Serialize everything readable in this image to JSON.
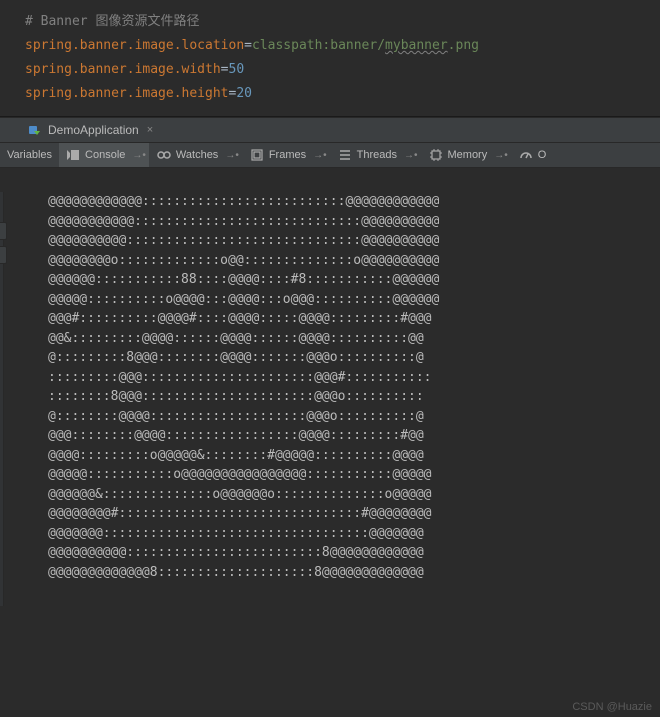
{
  "editor": {
    "comment": "# Banner 图像资源文件路径",
    "line1": {
      "key": "spring.banner.image.location",
      "eq": "=",
      "val_a": "classpath:banner/",
      "val_u": "mybanner",
      "val_c": ".png"
    },
    "line2": {
      "key": "spring.banner.image.width",
      "eq": "=",
      "val": "50"
    },
    "line3": {
      "key": "spring.banner.image.height",
      "eq": "=",
      "val": "20"
    }
  },
  "tab": {
    "name": "DemoApplication",
    "close": "×"
  },
  "toolbar": {
    "variables": "Variables",
    "console": "Console",
    "watches": "Watches",
    "frames": "Frames",
    "threads": "Threads",
    "memory": "Memory",
    "overhead": "O"
  },
  "banner_output": "@@@@@@@@@@@@::::::::::::::::::::::::::@@@@@@@@@@@@\n@@@@@@@@@@@:::::::::::::::::::::::::::::@@@@@@@@@@\n@@@@@@@@@@::::::::::::::::::::::::::::::@@@@@@@@@@\n@@@@@@@@o:::::::::::::o@@::::::::::::::o@@@@@@@@@@\n@@@@@@:::::::::::88::::@@@@::::#8:::::::::::@@@@@@\n@@@@@::::::::::o@@@@:::@@@@:::o@@@::::::::::@@@@@@\n@@@#::::::::::@@@@#::::@@@@:::::@@@@:::::::::#@@@\n@@&:::::::::@@@@::::::@@@@::::::@@@@::::::::::@@\n@:::::::::8@@@::::::::@@@@:::::::@@@o::::::::::@\n:::::::::@@@::::::::::::::::::::::@@@#:::::::::::\n::::::::8@@@::::::::::::::::::::::@@@o::::::::::\n@::::::::@@@@::::::::::::::::::::@@@o::::::::::@\n@@@::::::::@@@@:::::::::::::::::@@@@:::::::::#@@\n@@@@:::::::::o@@@@@&::::::::#@@@@@::::::::::@@@@\n@@@@@:::::::::::o@@@@@@@@@@@@@@@@:::::::::::@@@@@\n@@@@@@&::::::::::::::o@@@@@@o::::::::::::::o@@@@@\n@@@@@@@@#:::::::::::::::::::::::::::::::#@@@@@@@@\n@@@@@@@::::::::::::::::::::::::::::::::::@@@@@@@\n@@@@@@@@@@:::::::::::::::::::::::::8@@@@@@@@@@@@\n@@@@@@@@@@@@@8::::::::::::::::::::8@@@@@@@@@@@@@",
  "watermark": "CSDN @Huazie"
}
